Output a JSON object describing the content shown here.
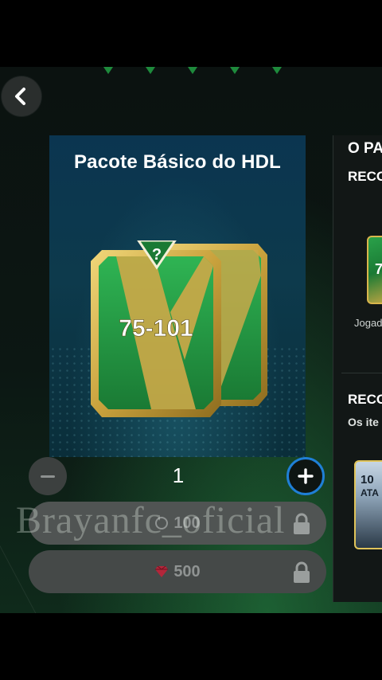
{
  "pack": {
    "title": "Pacote Básico do HDL",
    "rating_range": "75-101",
    "mystery_symbol": "?"
  },
  "quantity": {
    "value": "1",
    "minus_icon": "minus-icon",
    "plus_icon": "plus-icon"
  },
  "purchase": [
    {
      "price": "100",
      "currency_icon": "coin-icon",
      "locked": true
    },
    {
      "price": "500",
      "currency_icon": "gem-icon",
      "locked": true
    }
  ],
  "watermark": "Brayanfc_oficial",
  "side_panel": {
    "title": "O PA",
    "section1_title": "RECO",
    "item1_caption": "Jogado",
    "item1_rating": "7",
    "section2_title": "RECO",
    "section2_caption": "Os ite",
    "item2_rating": "10",
    "item2_position": "ATA"
  },
  "colors": {
    "accent_blue": "#1f7fd6",
    "pack_green": "#1f9a3f",
    "pack_gold": "#d4b04a",
    "gem_red": "#b3263a"
  }
}
